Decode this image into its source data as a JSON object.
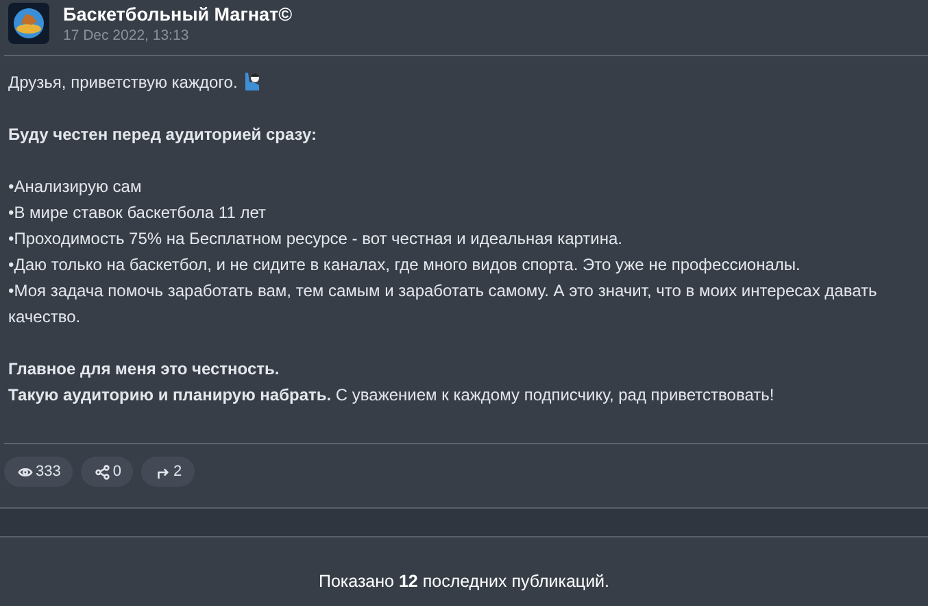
{
  "post": {
    "channel": "Баскетбольный Магнат©",
    "date": "17 Dec 2022, 13:13",
    "blocks": [
      {
        "lines": [
          {
            "text": "Друзья, приветствую каждого.",
            "bold": false,
            "emoji": true
          }
        ]
      },
      {
        "lines": [
          {
            "text": "Буду честен перед аудиторией сразу:",
            "bold": true,
            "emoji": false
          }
        ]
      },
      {
        "lines": [
          {
            "text": "•Анализирую сам",
            "bold": false,
            "emoji": false
          },
          {
            "text": "•В мире ставок баскетбола 11 лет",
            "bold": false,
            "emoji": false
          },
          {
            "text": "•Проходимость 75% на Бесплатном ресурсе - вот честная и идеальная картина.",
            "bold": false,
            "emoji": false
          },
          {
            "text": "•Даю только на баскетбол, и не сидите в каналах, где много видов спорта. Это уже не профессионалы.",
            "bold": false,
            "emoji": false
          },
          {
            "text": "•Моя задача помочь заработать вам, тем самым и заработать самому. А это значит, что в моих интересах давать качество.",
            "bold": false,
            "emoji": false
          }
        ]
      },
      {
        "lines": [
          {
            "text": "Главное для меня это честность.",
            "bold": true,
            "emoji": false
          },
          {
            "text": "**Такую аудиторию и планирую набрать.** С уважением к каждому подписчику, рад приветствовать!",
            "bold": false,
            "emoji": false
          }
        ]
      }
    ],
    "stats": [
      {
        "kind": "views",
        "value": "333"
      },
      {
        "kind": "shares",
        "value": "0"
      },
      {
        "kind": "forwards",
        "value": "2"
      }
    ]
  },
  "footer": "Показано **12** последних публикаций."
}
